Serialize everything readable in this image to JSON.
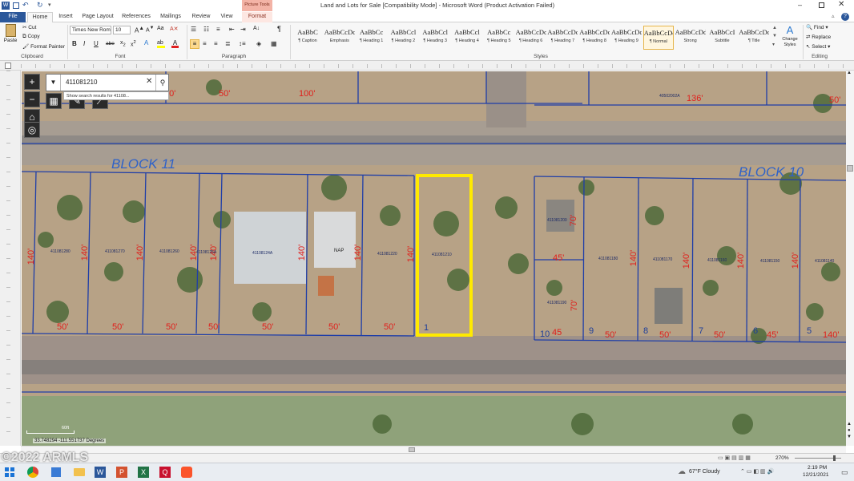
{
  "window": {
    "title": "Land and Lots for Sale [Compatibility Mode] - Microsoft Word (Product Activation Failed)",
    "context_tab": "Picture Tools"
  },
  "tabs": [
    "File",
    "Home",
    "Insert",
    "Page Layout",
    "References",
    "Mailings",
    "Review",
    "View",
    "Format"
  ],
  "ribbon": {
    "clipboard": {
      "paste": "Paste",
      "cut": "Cut",
      "copy": "Copy",
      "format_painter": "Format Painter",
      "label": "Clipboard"
    },
    "font": {
      "name": "Times New Rom",
      "size": "10",
      "label": "Font",
      "bold": "B",
      "italic": "I",
      "underline": "U",
      "strike": "abe"
    },
    "paragraph": {
      "label": "Paragraph",
      "pilcrow": "¶"
    },
    "styles": {
      "label": "Styles",
      "items": [
        {
          "preview": "AaBbC",
          "name": "¶ Caption"
        },
        {
          "preview": "AaBbCcDc",
          "name": "Emphasis"
        },
        {
          "preview": "AaBbCc",
          "name": "¶ Heading 1"
        },
        {
          "preview": "AaBbCcl",
          "name": "¶ Heading 2"
        },
        {
          "preview": "AaBbCcl",
          "name": "¶ Heading 3"
        },
        {
          "preview": "AaBbCcl",
          "name": "¶ Heading 4"
        },
        {
          "preview": "AaBbCc",
          "name": "¶ Heading 5"
        },
        {
          "preview": "AaBbCcDc",
          "name": "¶ Heading 6"
        },
        {
          "preview": "AaBbCcDc",
          "name": "¶ Heading 7"
        },
        {
          "preview": "AaBbCcDc",
          "name": "¶ Heading 8"
        },
        {
          "preview": "AaBbCcDc",
          "name": "¶ Heading 9"
        },
        {
          "preview": "AaBbCcDc",
          "name": "¶ Normal"
        },
        {
          "preview": "AaBbCcDd",
          "name": "Strong"
        },
        {
          "preview": "AaBbCcI",
          "name": "Subtitle"
        },
        {
          "preview": "AaBbCcDdl",
          "name": "¶ Title"
        }
      ],
      "change_styles": "Change Styles"
    },
    "editing": {
      "find": "Find",
      "replace": "Replace",
      "select": "Select",
      "label": "Editing"
    }
  },
  "map": {
    "search_value": "411081210",
    "search_hint": "Show search results for 41108...",
    "blocks": [
      "BLOCK 11",
      "BLOCK 10"
    ],
    "dimensions": [
      "50'",
      "50'",
      "100'",
      "136'",
      "50'",
      "140'",
      "140'",
      "140'",
      "140'",
      "140'",
      "140'",
      "140'",
      "140'",
      "50'",
      "50'",
      "50'",
      "50'",
      "50'",
      "50'",
      "50'",
      "50'",
      "50'",
      "50'",
      "45'",
      "70'",
      "70'",
      "45",
      "45'",
      "140'",
      "140'",
      "140'",
      "140'",
      "140'"
    ],
    "lots": [
      "1",
      "10",
      "9",
      "8",
      "7",
      "6",
      "5"
    ],
    "parcels": [
      "411081280",
      "411081270",
      "411081260",
      "41108125A",
      "41108124A",
      "NAP",
      "411081220",
      "411081210",
      "411081200",
      "411081190",
      "411081180",
      "411081170",
      "411081160",
      "411081150",
      "411081140",
      "40502002A"
    ],
    "coords": "33.748294 -111.551737 Degrees",
    "scale": "60ft",
    "watermark": "©2022 ARMLS"
  },
  "status": {
    "zoom": "270%"
  },
  "taskbar": {
    "weather": "67°F  Cloudy",
    "time": "2:19 PM",
    "date": "12/21/2021"
  },
  "colors": {
    "highlight": "#ffea00",
    "parcel_line": "#1f3ea8",
    "dimension": "#e0201c"
  }
}
